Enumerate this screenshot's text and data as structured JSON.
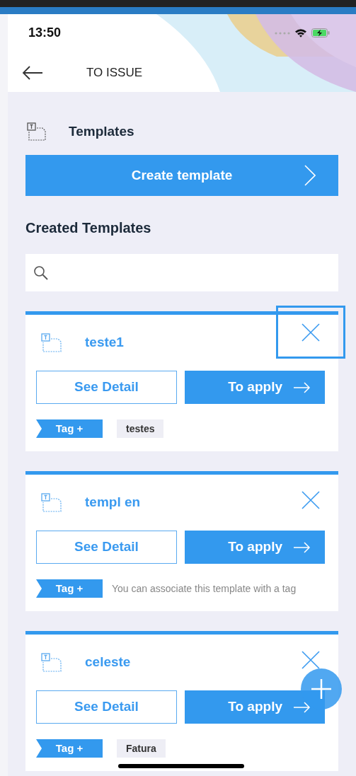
{
  "status_bar": {
    "time": "13:50"
  },
  "header": {
    "title": "TO ISSUE"
  },
  "section": {
    "title": "Templates"
  },
  "create_button": {
    "label": "Create template"
  },
  "list_title": "Created Templates",
  "templates": [
    {
      "name": "teste1",
      "close_focused": true,
      "detail_label": "See Detail",
      "apply_label": "To apply",
      "tag_button": "Tag +",
      "tags": [
        {
          "kind": "tag",
          "text": "testes"
        }
      ]
    },
    {
      "name": "templ en",
      "close_focused": false,
      "detail_label": "See Detail",
      "apply_label": "To apply",
      "tag_button": "Tag +",
      "tags": [
        {
          "kind": "hint",
          "text": "You can associate this template with a tag"
        }
      ]
    },
    {
      "name": "celeste",
      "close_focused": false,
      "detail_label": "See Detail",
      "apply_label": "To apply",
      "tag_button": "Tag +",
      "tags": [
        {
          "kind": "tag",
          "text": "Fatura"
        }
      ]
    }
  ]
}
